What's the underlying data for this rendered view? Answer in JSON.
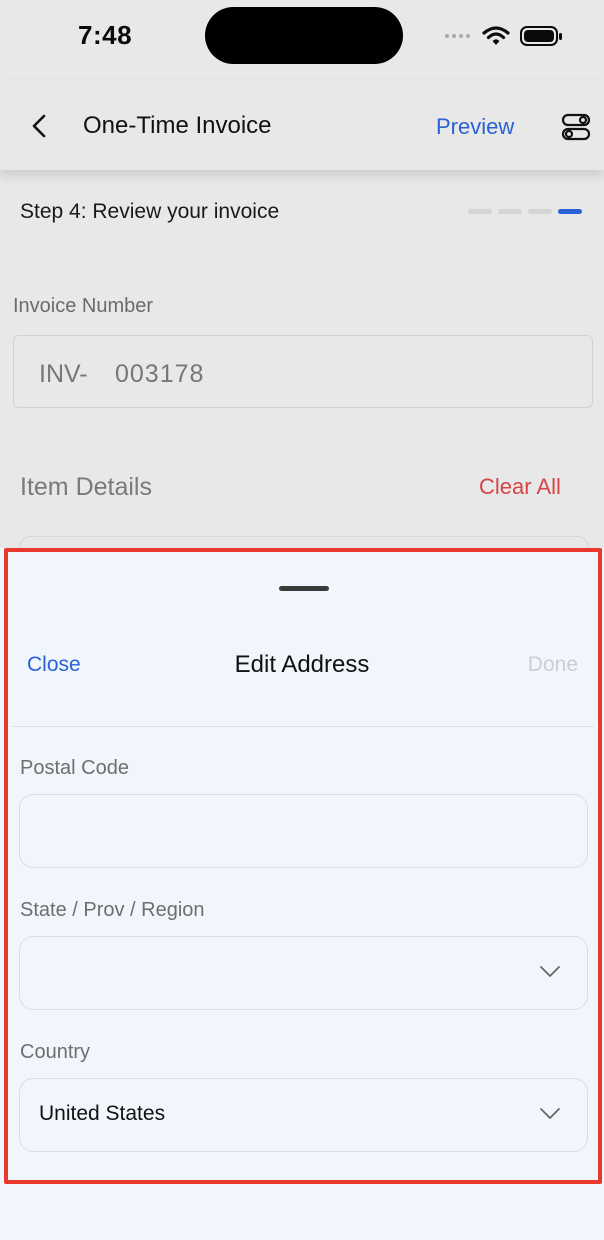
{
  "status_bar": {
    "time": "7:48"
  },
  "header": {
    "back_icon": "chevron-left-icon",
    "title": "One-Time Invoice",
    "preview_label": "Preview",
    "settings_icon": "toggles-icon"
  },
  "step": {
    "label": "Step 4: Review your invoice",
    "current": 4,
    "total": 4
  },
  "invoice": {
    "label": "Invoice Number",
    "prefix": "INV-",
    "number": "003178"
  },
  "items": {
    "heading": "Item Details",
    "clear_all_label": "Clear All"
  },
  "sheet": {
    "close_label": "Close",
    "title": "Edit Address",
    "done_label": "Done",
    "postal_code": {
      "label": "Postal Code",
      "value": ""
    },
    "state": {
      "label": "State / Prov / Region",
      "value": ""
    },
    "country": {
      "label": "Country",
      "value": "United States"
    }
  },
  "colors": {
    "accent": "#2a62d6",
    "danger": "#d64545",
    "highlight": "#e8392c",
    "sheet_background": "#f1f6fd"
  }
}
